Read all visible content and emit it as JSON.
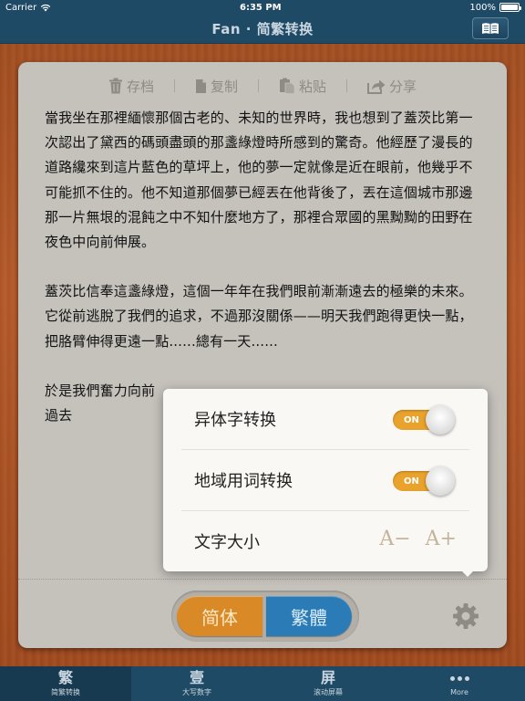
{
  "status_bar": {
    "carrier": "Carrier",
    "time": "6:35 PM",
    "battery": "100%",
    "battery_level": 1.0
  },
  "nav": {
    "title": "Fan · 简繁转换",
    "right_icon": "book-icon"
  },
  "toolbar": {
    "archive_label": "存档",
    "copy_label": "复制",
    "paste_label": "粘贴",
    "share_label": "分享"
  },
  "text": {
    "p1": "當我坐在那裡緬懷那個古老的、未知的世界時，我也想到了蓋茨比第一次認出了黛西的碼頭盡頭的那盞綠燈時所感到的驚奇。他經歷了漫長的道路纔來到這片藍色的草坪上，他的夢一定就像是近在眼前，他幾乎不可能抓不住的。他不知道那個夢已經丟在他背後了，丟在這個城市那邊那一片無垠的混飩之中不知什麼地方了，那裡合眾國的黑黝黝的田野在夜色中向前伸展。",
    "p2": "蓋茨比信奉這盞綠燈，這個一年年在我們眼前漸漸遠去的極樂的未來。它從前逃脫了我們的追求，不過那沒關係——明天我們跑得更快一點，把胳臂伸得更遠一點......總有一天......",
    "p3_visible": "於是我們奮力向前",
    "p3_end": "過去"
  },
  "controls": {
    "simplified_label": "简体",
    "traditional_label": "繁體",
    "settings_icon": "gear-icon"
  },
  "popover": {
    "variant_label": "异体字转换",
    "variant_state": "ON",
    "regional_label": "地域用词转换",
    "regional_state": "ON",
    "font_size_label": "文字大小",
    "decrease_label": "A−",
    "increase_label": "A+"
  },
  "tabs": [
    {
      "glyph": "繁",
      "label": "简繁转换"
    },
    {
      "glyph": "壹",
      "label": "大写数字"
    },
    {
      "glyph": "屏",
      "label": "滚动屏幕"
    },
    {
      "glyph": "",
      "label": "More"
    }
  ],
  "colors": {
    "accent_orange": "#d98a26",
    "accent_blue": "#2a7bb6",
    "nav_bg": "#1f4a66",
    "toggle_on": "#e9a22b"
  }
}
